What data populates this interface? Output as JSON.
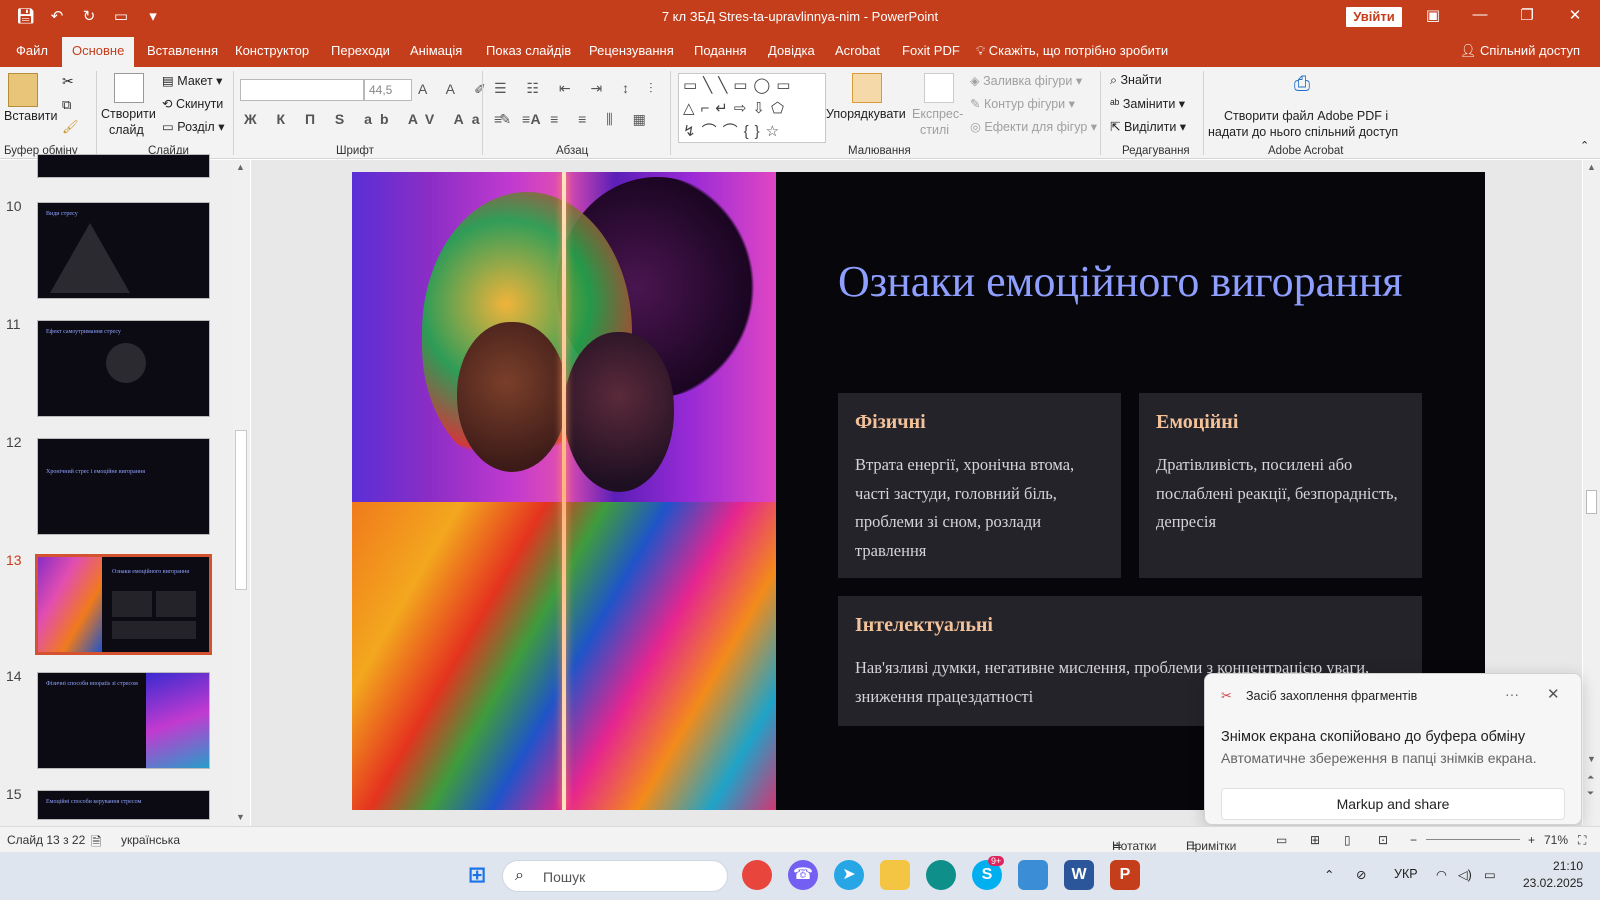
{
  "window": {
    "title": "7 кл ЗБД Stres-ta-upravlinnya-nim  -  PowerPoint",
    "signin_label": "Увійти"
  },
  "tabs": [
    {
      "label": "Файл"
    },
    {
      "label": "Основне"
    },
    {
      "label": "Вставлення"
    },
    {
      "label": "Конструктор"
    },
    {
      "label": "Переходи"
    },
    {
      "label": "Анімація"
    },
    {
      "label": "Показ слайдів"
    },
    {
      "label": "Рецензування"
    },
    {
      "label": "Подання"
    },
    {
      "label": "Довідка"
    },
    {
      "label": "Acrobat"
    },
    {
      "label": "Foxit PDF"
    },
    {
      "label": "Скажіть, що потрібно зробити"
    }
  ],
  "share_label": "Спільний доступ",
  "ribbon": {
    "clipboard": {
      "paste": "Вставити",
      "label": "Буфер обміну"
    },
    "slides": {
      "new_slide_1": "Створити",
      "new_slide_2": "слайд",
      "layout": "Макет",
      "reset": "Скинути",
      "section": "Розділ",
      "label": "Слайди"
    },
    "font": {
      "size": "44,5",
      "label": "Шрифт"
    },
    "paragraph": {
      "label": "Абзац"
    },
    "drawing": {
      "arrange": "Упорядкувати",
      "quick_styles_1": "Експрес-",
      "quick_styles_2": "стилі",
      "fill": "Заливка фігури",
      "outline": "Контур фігури",
      "effects": "Ефекти для фігур",
      "label": "Малювання"
    },
    "editing": {
      "find": "Знайти",
      "replace": "Замінити",
      "select": "Виділити",
      "label": "Редагування"
    },
    "acrobat": {
      "create_1": "Створити файл Adobe PDF і",
      "create_2": "надати до нього спільний доступ",
      "label": "Adobe Acrobat"
    }
  },
  "thumbnails": [
    {
      "number": "10",
      "title": "Види стресу"
    },
    {
      "number": "11",
      "title": "Ефект самоутримання стресу"
    },
    {
      "number": "12",
      "title": "Хронічний стрес і емоційне вигорання"
    },
    {
      "number": "13",
      "title": "Ознаки емоційного вигорання"
    },
    {
      "number": "14",
      "title": "Фізичні способи впорatis зі стресом"
    },
    {
      "number": "15",
      "title": "Емоційні способи керування стресом"
    }
  ],
  "slide": {
    "title": "Ознаки емоційного вигорання",
    "cards": [
      {
        "heading": "Фізичні",
        "body": "Втрата енергії, хронічна втома, часті застуди, головний біль, проблеми зі сном, розлади травлення"
      },
      {
        "heading": "Емоційні",
        "body": "Дратівливість, посилені або послаблені реакції, безпорадність, депресія"
      },
      {
        "heading": "Інтелектуальні",
        "body": "Нав'язливі думки, негативне мислення, проблеми з концентрацією уваги, зниження працездатності"
      }
    ]
  },
  "toast": {
    "app_name": "Засіб захоплення фрагментів",
    "message": "Знімок екрана скопійовано до буфера обміну",
    "sub": "Автоматичне збереження в папці знімків екрана.",
    "action": "Markup and share"
  },
  "statusbar": {
    "slide_info": "Слайд 13 з 22",
    "language": "українська",
    "notes": "Нотатки",
    "comments": "Примітки",
    "zoom": "71%"
  },
  "taskbar": {
    "search_placeholder": "Пошук",
    "lang": "УКР",
    "time": "21:10",
    "date": "23.02.2025",
    "skype_badge": "9+"
  },
  "colors": {
    "accent": "#c43e1c",
    "slide_title": "#8f9fff",
    "card_heading": "#f3c29a"
  }
}
